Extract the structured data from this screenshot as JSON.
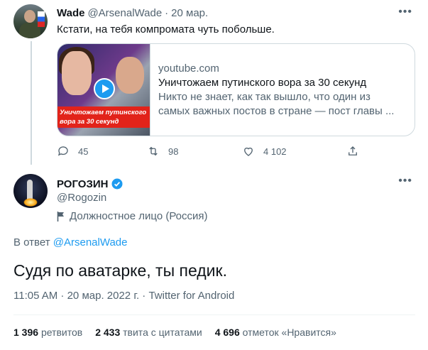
{
  "parent_tweet": {
    "name": "Wade",
    "handle": "@ArsenalWade",
    "separator": "·",
    "date": "20 мар.",
    "text": "Кстати, на тебя компромата чуть побольше.",
    "card": {
      "thumb_text": "Уничтожаем путинского вора за 30 секунд",
      "domain": "youtube.com",
      "title": "Уничтожаем путинского вора за 30 секунд",
      "description_line1": "Никто не знает, как так вышло, что один из",
      "description_line2": "самых важных постов в стране — пост главы ..."
    },
    "actions": {
      "replies": "45",
      "retweets": "98",
      "likes": "4 102"
    },
    "more_label": "•••"
  },
  "main_tweet": {
    "name": "РОГОЗИН",
    "handle": "@Rogozin",
    "account_label": "Должностное лицо (Россия)",
    "reply_prefix": "В ответ",
    "reply_handle": "@ArsenalWade",
    "text": "Судя по аватарке, ты педик.",
    "meta": "11:05 AM · 20 мар. 2022 г. · Twitter for Android",
    "more_label": "•••",
    "stats": {
      "retweets_count": "1 396",
      "retweets_label": "ретвитов",
      "quotes_count": "2 433",
      "quotes_label": "твита с цитатами",
      "likes_count": "4 696",
      "likes_label": "отметок «Нравится»"
    }
  },
  "colors": {
    "link": "#1d9bf0",
    "muted": "#536471",
    "border": "#cfd9de"
  }
}
